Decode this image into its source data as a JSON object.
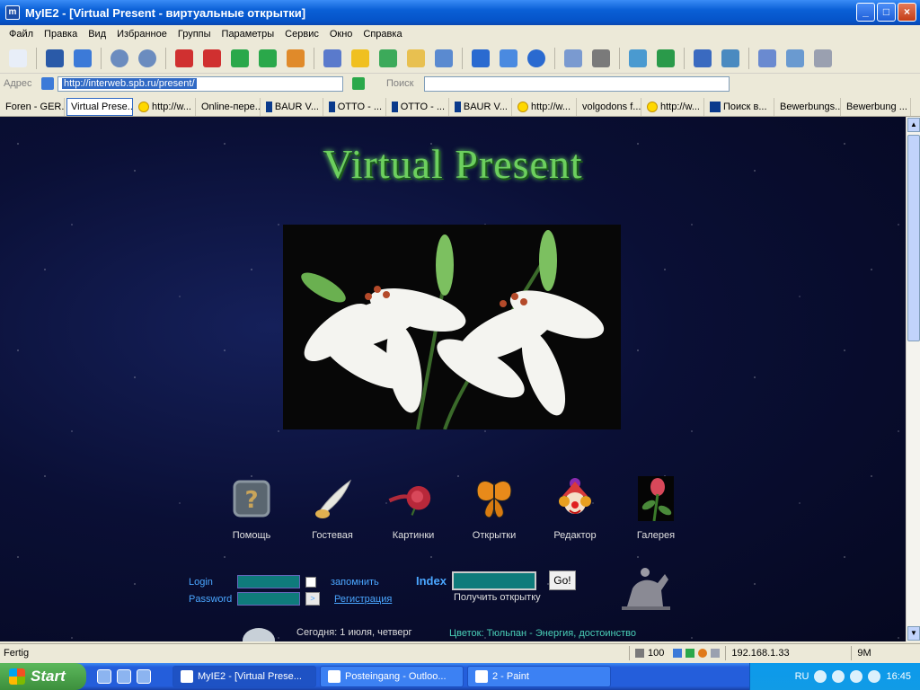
{
  "window": {
    "title": "MyIE2 - [Virtual Present - виртуальные открытки]",
    "app_icon_label": "m",
    "minimize": "_",
    "maximize": "□",
    "close": "×"
  },
  "menu": [
    "Файл",
    "Правка",
    "Вид",
    "Избранное",
    "Группы",
    "Параметры",
    "Сервис",
    "Окно",
    "Справка"
  ],
  "toolbar": {
    "icons": [
      "new-icon",
      "save-icon",
      "ie-icon",
      "back-icon",
      "forward-icon",
      "stop-icon",
      "stop-all-icon",
      "refresh-icon",
      "refresh-all-icon",
      "home-icon",
      "search-icon",
      "favorites-icon",
      "history-icon",
      "folder-icon",
      "notes-icon",
      "text-size-icon",
      "font-icon",
      "globe-icon",
      "mail-icon",
      "print-icon",
      "popup-icon",
      "download-icon",
      "undo-icon",
      "new-window-icon",
      "layout-icon",
      "edit-icon",
      "options-icon"
    ],
    "colors": [
      "#e8eef8",
      "#2a5aa8",
      "#3c7ad8",
      "#6b8cbf",
      "#6b8cbf",
      "#d03030",
      "#d03030",
      "#2aa84a",
      "#2aa84a",
      "#e08a2a",
      "#5a7acc",
      "#f0c020",
      "#3caa5a",
      "#e8c050",
      "#5a8ad0",
      "#2a6ad0",
      "#4a8ae0",
      "#2a6ad0",
      "#7a9ad0",
      "#7a7a7a",
      "#4a9ad0",
      "#2a9a4a",
      "#3a6ac0",
      "#4a8ac0",
      "#6a8ad0",
      "#6a9ad0",
      "#9aa0b0"
    ]
  },
  "address_bar": {
    "label": "Адрес",
    "url": "http://interweb.spb.ru/present/",
    "search_label": "Поиск"
  },
  "tabs": [
    {
      "label": "Foren - GER...",
      "icon": "none"
    },
    {
      "label": "Virtual Prese...",
      "icon": "none",
      "active": true
    },
    {
      "label": "http://w...",
      "icon": "smiley"
    },
    {
      "label": "Online-пере...",
      "icon": "none"
    },
    {
      "label": "BAUR V...",
      "icon": "B"
    },
    {
      "label": "OTTO - ...",
      "icon": "OTTO"
    },
    {
      "label": "OTTO - ...",
      "icon": "OTTO"
    },
    {
      "label": "BAUR V...",
      "icon": "B"
    },
    {
      "label": "http://w...",
      "icon": "smiley"
    },
    {
      "label": "volgodons f...",
      "icon": "none"
    },
    {
      "label": "http://w...",
      "icon": "smiley"
    },
    {
      "label": "Поиск в...",
      "icon": "G"
    },
    {
      "label": "Bewerbungs...",
      "icon": "none"
    },
    {
      "label": "Bewerbung ...",
      "icon": "none"
    }
  ],
  "page": {
    "site_title": "Virtual Present",
    "nav": [
      {
        "label": "Помощь",
        "icon": "question-icon"
      },
      {
        "label": "Гостевая",
        "icon": "quill-icon"
      },
      {
        "label": "Картинки",
        "icon": "rose-icon"
      },
      {
        "label": "Открытки",
        "icon": "butterfly-icon"
      },
      {
        "label": "Редактор",
        "icon": "clown-icon"
      },
      {
        "label": "Галерея",
        "icon": "rosebud-icon"
      }
    ],
    "login": {
      "login_label": "Login",
      "password_label": "Password",
      "remember_label": "запомнить",
      "submit_label": ">",
      "register_link": "Регистрация"
    },
    "index": {
      "label": "Index",
      "go_button": "Go!",
      "caption": "Получить открытку"
    },
    "today": "Сегодня: 1 июля, четверг",
    "flower_of_day": "Цветок: Тюльпан - Энергия, достоинство"
  },
  "status_bar": {
    "text": "Fertig",
    "zoom": "100",
    "ip": "192.168.1.33",
    "memory": "9M"
  },
  "taskbar": {
    "start": "Start",
    "tasks": [
      {
        "label": "MyIE2 - [Virtual Prese...",
        "active": true
      },
      {
        "label": "Posteingang - Outloo...",
        "active": false
      },
      {
        "label": "2 - Paint",
        "active": false
      }
    ],
    "tray_lang": "RU",
    "clock": "16:45"
  }
}
